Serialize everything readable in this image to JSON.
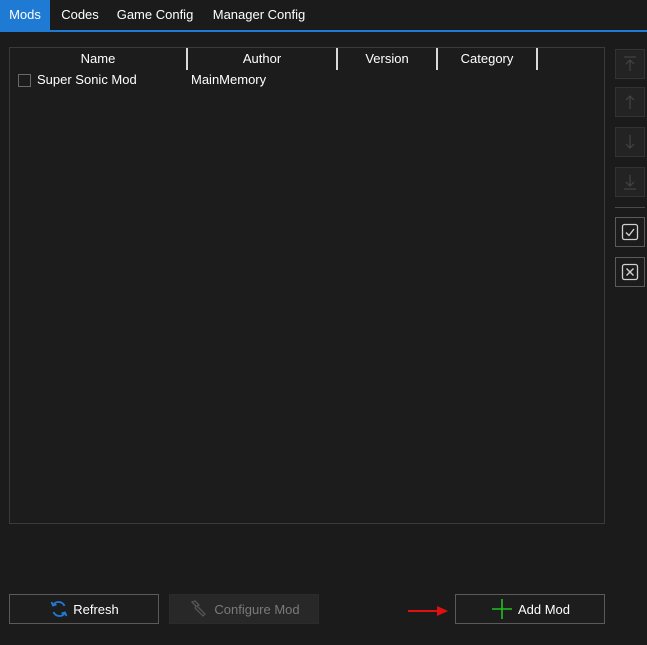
{
  "tabs": [
    {
      "label": "Mods",
      "active": true
    },
    {
      "label": "Codes",
      "active": false
    },
    {
      "label": "Game Config",
      "active": false
    },
    {
      "label": "Manager Config",
      "active": false
    }
  ],
  "mod_list": {
    "columns": [
      "Name",
      "Author",
      "Version",
      "Category"
    ],
    "rows": [
      {
        "checked": false,
        "name": "Super Sonic Mod",
        "author": "MainMemory",
        "version": "",
        "category": ""
      }
    ]
  },
  "side_buttons": [
    {
      "icon": "move-to-top-icon",
      "enabled": false
    },
    {
      "icon": "move-up-icon",
      "enabled": false
    },
    {
      "icon": "move-down-icon",
      "enabled": false
    },
    {
      "icon": "move-to-bottom-icon",
      "enabled": false
    },
    {
      "icon": "check-all-icon",
      "enabled": true
    },
    {
      "icon": "uncheck-all-icon",
      "enabled": true
    }
  ],
  "buttons": {
    "refresh": {
      "label": "Refresh",
      "icon": "refresh-icon",
      "enabled": true
    },
    "configure": {
      "label": "Configure Mod",
      "icon": "wrench-icon",
      "enabled": false
    },
    "add": {
      "label": "Add Mod",
      "icon": "plus-icon",
      "enabled": true
    }
  },
  "colors": {
    "accent": "#1f7ad3",
    "background": "#1b1b1b",
    "add_icon": "#22c022",
    "refresh_icon": "#1f7ad3",
    "annotation_arrow": "#e01010"
  }
}
